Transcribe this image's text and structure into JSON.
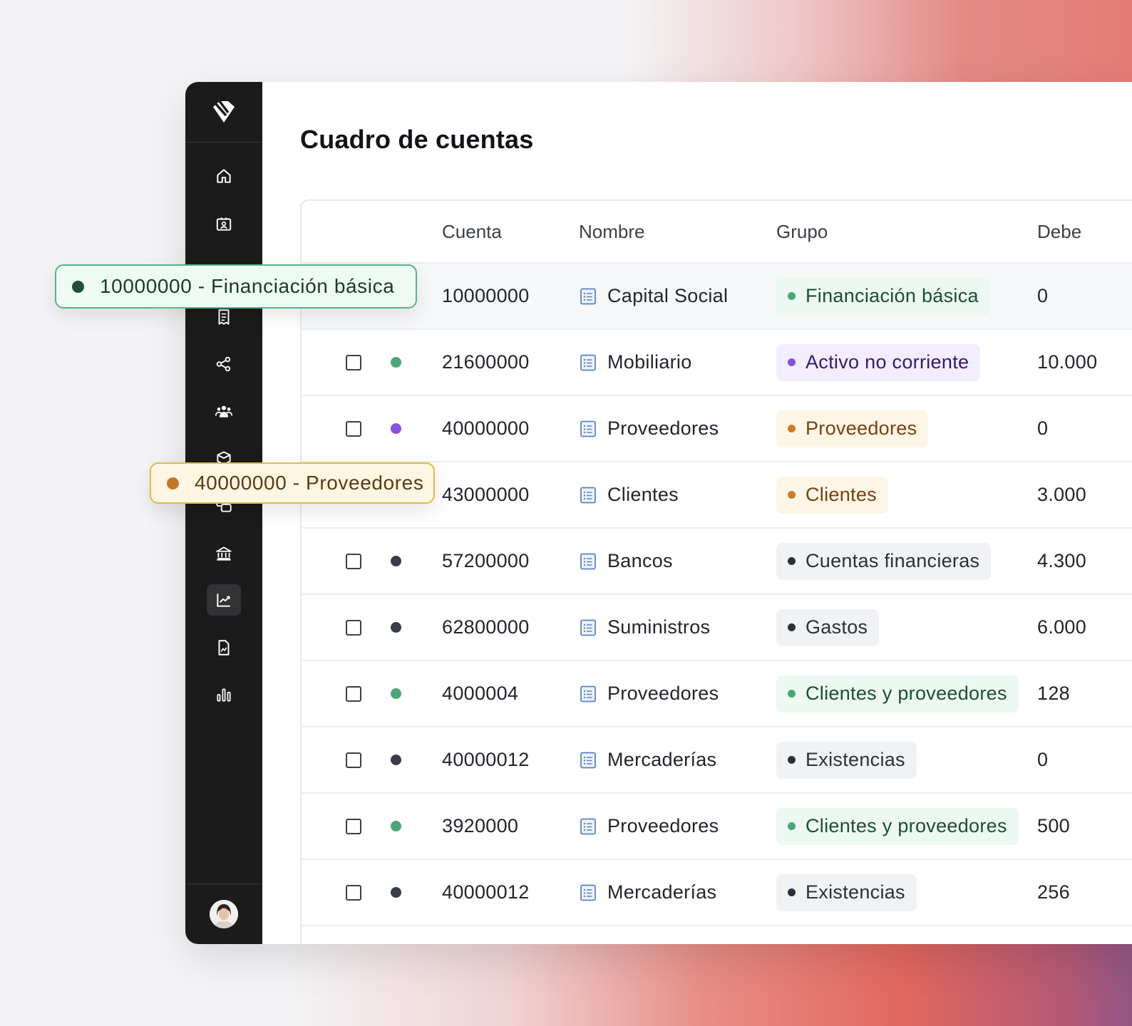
{
  "page_title": "Cuadro de cuentas",
  "colors": {
    "sidebar_bg": "#1b1b1c",
    "accent_green": "#4aa677",
    "accent_purple": "#8b4fe0",
    "accent_orange": "#d17a2a",
    "dark_dot": "#3a3d45"
  },
  "sidebar": {
    "logo_icon": "diamond-logo-icon",
    "items": [
      {
        "icon": "home-icon",
        "active": false
      },
      {
        "icon": "contact-card-icon",
        "active": false
      },
      {
        "icon": "receipt-icon",
        "active": false
      },
      {
        "icon": "share-nodes-icon",
        "active": false
      },
      {
        "icon": "users-group-icon",
        "active": false
      },
      {
        "icon": "box-icon",
        "active": false
      },
      {
        "icon": "chat-icon",
        "active": false
      },
      {
        "icon": "bank-icon",
        "active": false
      },
      {
        "icon": "chart-trend-icon",
        "active": true
      },
      {
        "icon": "document-chart-icon",
        "active": false
      },
      {
        "icon": "bar-chart-icon",
        "active": false
      }
    ],
    "avatar_icon": "user-avatar-icon"
  },
  "table": {
    "columns": {
      "cuenta": "Cuenta",
      "nombre": "Nombre",
      "grupo": "Grupo",
      "debe": "Debe"
    },
    "rows": [
      {
        "cuenta": "10000000",
        "nombre": "Capital Social",
        "grupo": "Financiación básica",
        "debe": "0",
        "dot": "green",
        "chip": "green",
        "highlight": true
      },
      {
        "cuenta": "21600000",
        "nombre": "Mobiliario",
        "grupo": "Activo no corriente",
        "debe": "10.000",
        "dot": "green",
        "chip": "purple"
      },
      {
        "cuenta": "40000000",
        "nombre": "Proveedores",
        "grupo": "Proveedores",
        "debe": "0",
        "dot": "purple",
        "chip": "orange"
      },
      {
        "cuenta": "43000000",
        "nombre": "Clientes",
        "grupo": "Clientes",
        "debe": "3.000",
        "dot": "orange",
        "chip": "orange"
      },
      {
        "cuenta": "57200000",
        "nombre": "Bancos",
        "grupo": "Cuentas financieras",
        "debe": "4.300",
        "dot": "dark",
        "chip": "gray"
      },
      {
        "cuenta": "62800000",
        "nombre": "Suministros",
        "grupo": "Gastos",
        "debe": "6.000",
        "dot": "dark",
        "chip": "gray"
      },
      {
        "cuenta": "4000004",
        "nombre": "Proveedores",
        "grupo": "Clientes y proveedores",
        "debe": "128",
        "dot": "green",
        "chip": "green"
      },
      {
        "cuenta": "40000012",
        "nombre": "Mercaderías",
        "grupo": "Existencias",
        "debe": "0",
        "dot": "dark",
        "chip": "gray"
      },
      {
        "cuenta": "3920000",
        "nombre": "Proveedores",
        "grupo": "Clientes y proveedores",
        "debe": "500",
        "dot": "green",
        "chip": "green"
      },
      {
        "cuenta": "40000012",
        "nombre": "Mercaderías",
        "grupo": "Existencias",
        "debe": "256",
        "dot": "dark",
        "chip": "gray"
      }
    ]
  },
  "tooltips": {
    "green": "10000000 - Financiación básica",
    "yellow": "40000000 - Proveedores"
  }
}
